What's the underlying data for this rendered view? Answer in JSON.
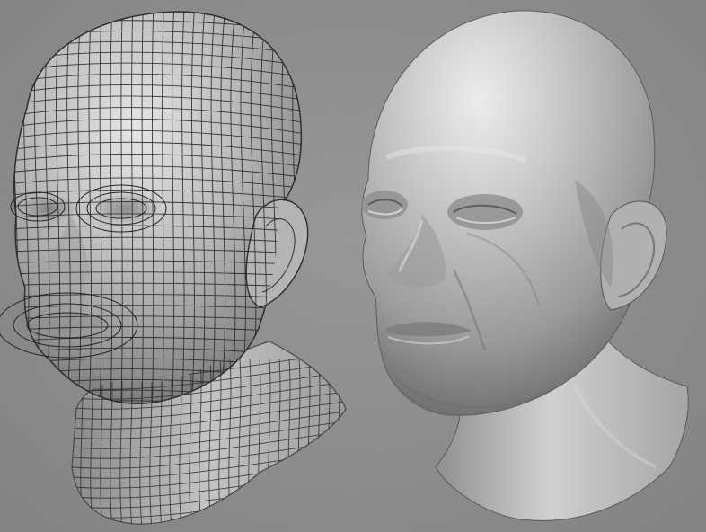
{
  "scene": {
    "background_color": "#8e8e8e",
    "subjects": [
      {
        "name": "wireframe-head",
        "style": "quad topology mesh over gray shaded sculpt"
      },
      {
        "name": "sculpted-head",
        "style": "smooth gray clay sculpt, eyes closed"
      }
    ],
    "colors": {
      "clay_light": "#d8d8d8",
      "clay_mid": "#aaaaaa",
      "clay_dark": "#6a6a6a",
      "wire": "#2a2a2a"
    }
  }
}
